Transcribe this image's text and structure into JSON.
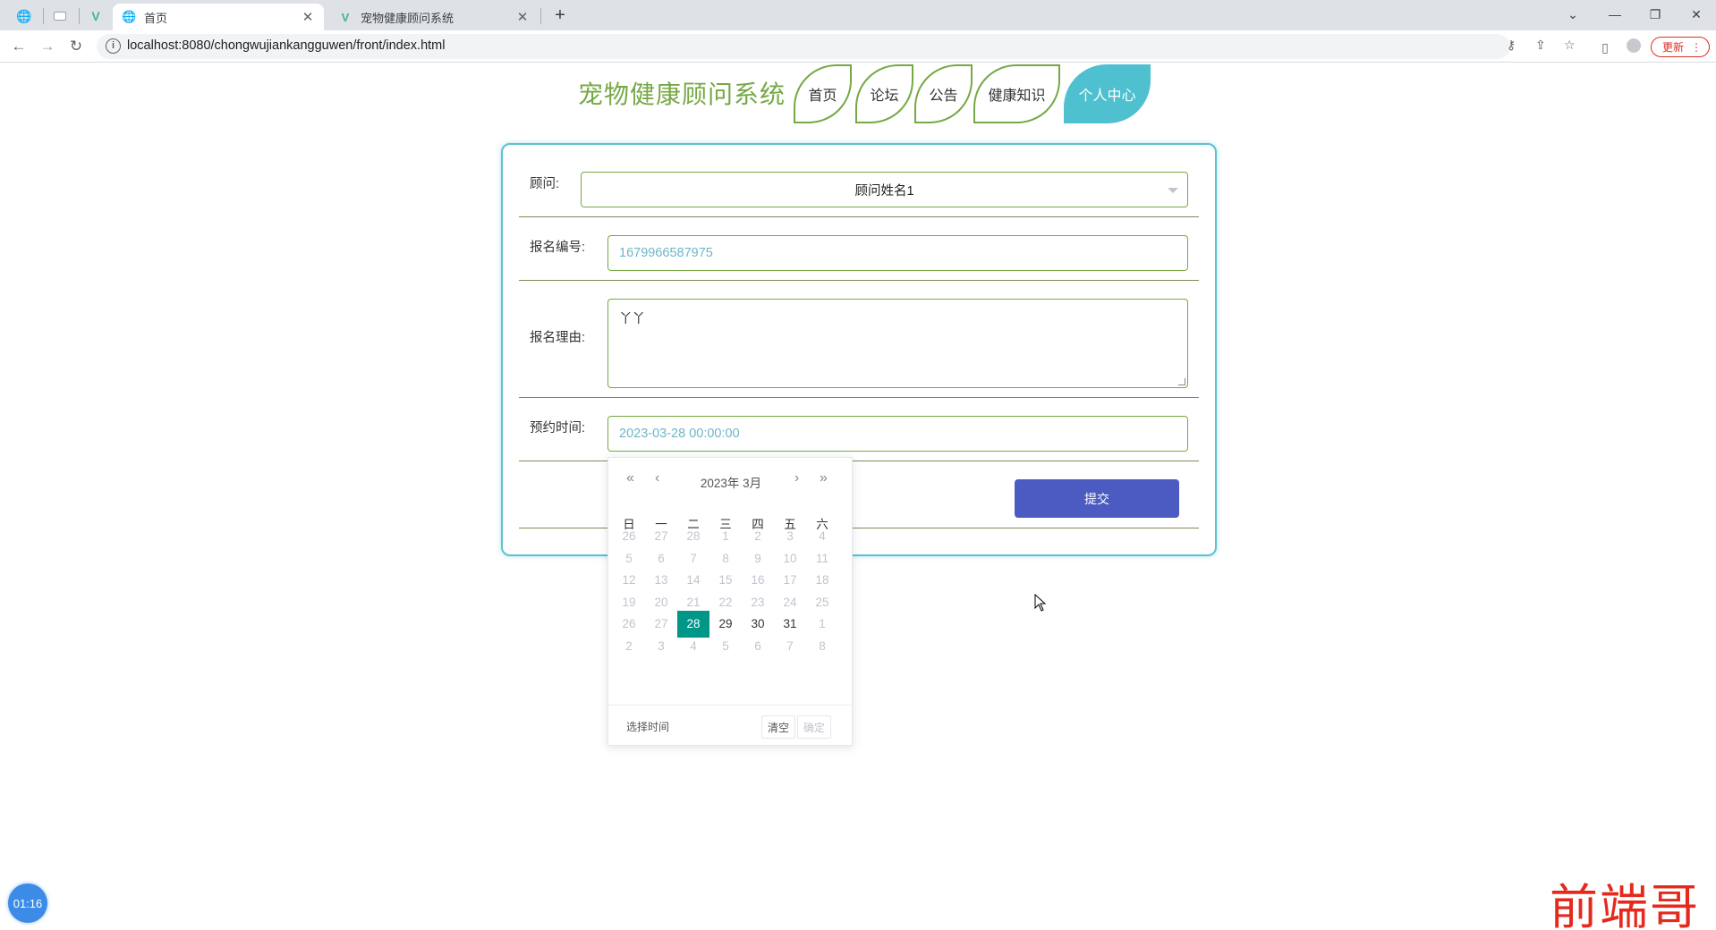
{
  "browser": {
    "tabs": [
      {
        "label": "首页",
        "icon": "globe-icon",
        "active": true
      },
      {
        "label": "宠物健康顾问系统",
        "icon": "vue-logo-icon",
        "active": false
      }
    ],
    "url": "localhost:8080/chongwujiankangguwen/front/index.html",
    "update_label": "更新"
  },
  "header": {
    "title": "宠物健康顾问系统",
    "nav": [
      {
        "label": "首页",
        "active": false
      },
      {
        "label": "论坛",
        "active": false
      },
      {
        "label": "公告",
        "active": false
      },
      {
        "label": "健康知识",
        "active": false
      },
      {
        "label": "个人中心",
        "active": true
      }
    ]
  },
  "form": {
    "advisor_label": "顾问:",
    "advisor_value": "顾问姓名1",
    "number_label": "报名编号:",
    "number_value": "1679966587975",
    "reason_label": "报名理由:",
    "reason_value": "丫丫",
    "time_label": "预约时间:",
    "time_value": "2023-03-28 00:00:00",
    "submit_label": "提交"
  },
  "datepicker": {
    "year_month": "2023年  3月",
    "weekdays": [
      "日",
      "一",
      "二",
      "三",
      "四",
      "五",
      "六"
    ],
    "weeks": [
      [
        "26",
        "27",
        "28",
        "1",
        "2",
        "3",
        "4"
      ],
      [
        "5",
        "6",
        "7",
        "8",
        "9",
        "10",
        "11"
      ],
      [
        "12",
        "13",
        "14",
        "15",
        "16",
        "17",
        "18"
      ],
      [
        "19",
        "20",
        "21",
        "22",
        "23",
        "24",
        "25"
      ],
      [
        "26",
        "27",
        "28",
        "29",
        "30",
        "31",
        "1"
      ],
      [
        "2",
        "3",
        "4",
        "5",
        "6",
        "7",
        "8"
      ]
    ],
    "selected": "28",
    "select_time_label": "选择时间",
    "clear_label": "清空",
    "confirm_label": "确定"
  },
  "timer": "01:16",
  "watermark": "前端哥",
  "colors": {
    "green": "#76a844",
    "teal": "#4fc0cf",
    "submit": "#4b5bc1",
    "selected_day": "#009688"
  }
}
